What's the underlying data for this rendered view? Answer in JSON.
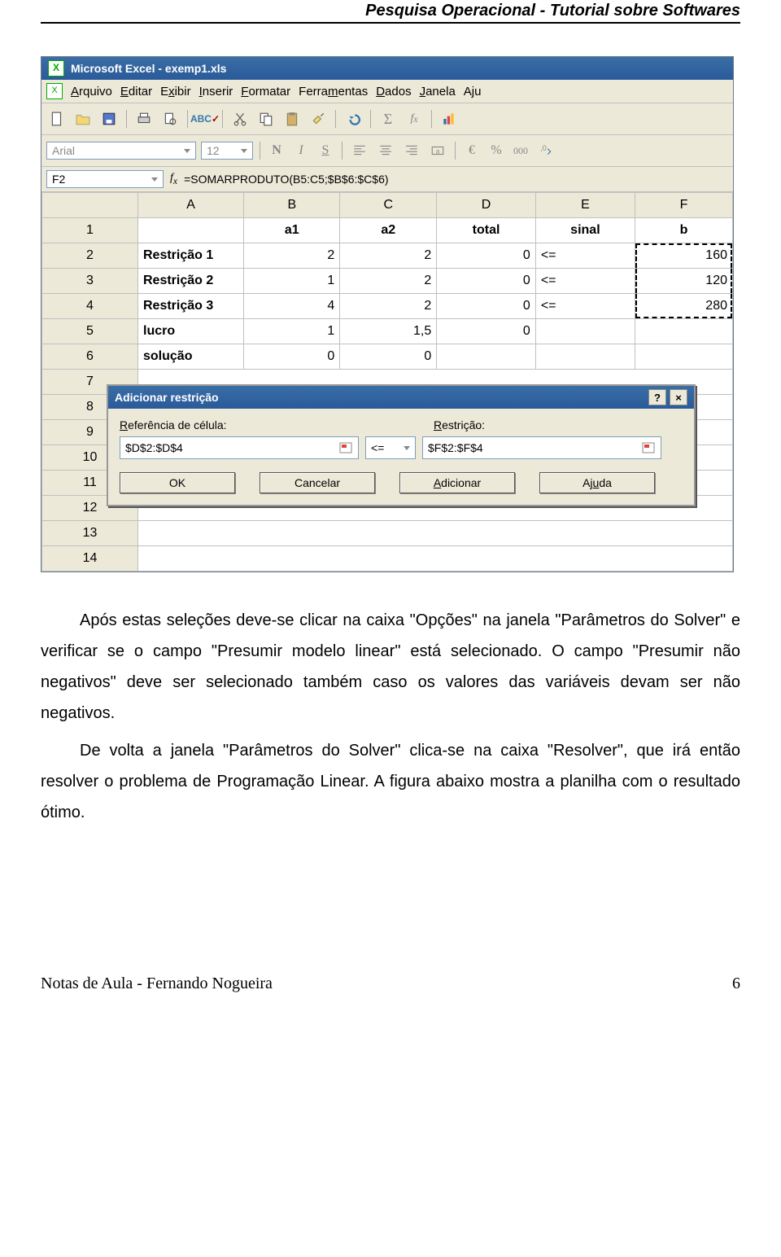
{
  "doc_header": "Pesquisa Operacional - Tutorial sobre Softwares",
  "excel": {
    "title": "Microsoft Excel - exemp1.xls",
    "menu": [
      "Arquivo",
      "Editar",
      "Exibir",
      "Inserir",
      "Formatar",
      "Ferramentas",
      "Dados",
      "Janela",
      "Aju"
    ],
    "menu_underline": [
      "A",
      "E",
      "x",
      "I",
      "F",
      "m",
      "D",
      "J",
      ""
    ],
    "font_name": "Arial",
    "font_size": "12",
    "name_box": "F2",
    "formula": "=SOMARPRODUTO(B5:C5;$B$6:$C$6)",
    "format_extras": {
      "currency": "€",
      "percent": "%",
      "thousands": "000"
    },
    "columns": [
      "A",
      "B",
      "C",
      "D",
      "E",
      "F"
    ],
    "headers_row": {
      "B": "a1",
      "C": "a2",
      "D": "total",
      "E": "sinal",
      "F": "b"
    },
    "rows": [
      {
        "n": "1",
        "A": "",
        "B": "a1",
        "C": "a2",
        "D": "total",
        "E": "sinal",
        "F": "b",
        "bold": true,
        "align": "ctr"
      },
      {
        "n": "2",
        "A": "Restrição 1",
        "B": "2",
        "C": "2",
        "D": "0",
        "E": "<=",
        "F": "160"
      },
      {
        "n": "3",
        "A": "Restrição 2",
        "B": "1",
        "C": "2",
        "D": "0",
        "E": "<=",
        "F": "120"
      },
      {
        "n": "4",
        "A": "Restrição 3",
        "B": "4",
        "C": "2",
        "D": "0",
        "E": "<=",
        "F": "280"
      },
      {
        "n": "5",
        "A": "lucro",
        "B": "1",
        "C": "1,5",
        "D": "0",
        "E": "",
        "F": ""
      },
      {
        "n": "6",
        "A": "solução",
        "B": "0",
        "C": "0",
        "D": "",
        "E": "",
        "F": ""
      },
      {
        "n": "7"
      },
      {
        "n": "8"
      },
      {
        "n": "9"
      },
      {
        "n": "10"
      },
      {
        "n": "11"
      },
      {
        "n": "12"
      },
      {
        "n": "13"
      },
      {
        "n": "14"
      }
    ]
  },
  "dialog": {
    "title": "Adicionar restrição",
    "label_ref": "Referência de célula:",
    "label_restr": "Restrição:",
    "ref_value": "$D$2:$D$4",
    "op_value": "<=",
    "restr_value": "$F$2:$F$4",
    "btns": {
      "ok": "OK",
      "cancel": "Cancelar",
      "add": "Adicionar",
      "help": "Ajuda"
    },
    "btn_underline": {
      "cancel": "",
      "add": "A",
      "help": "u",
      "ref": "R",
      "restr": "R"
    }
  },
  "paragraphs": {
    "p1": "Após estas seleções deve-se clicar na caixa \"Opções\" na janela \"Parâmetros do Solver\" e verificar se o campo \"Presumir modelo linear\" está selecionado. O campo \"Presumir não negativos\" deve ser selecionado também caso os valores das variáveis devam ser não negativos.",
    "p2": "De volta a janela \"Parâmetros do Solver\" clica-se na caixa \"Resolver\", que irá então resolver o problema de Programação Linear. A figura abaixo mostra a planilha com o resultado ótimo."
  },
  "footer": {
    "left": "Notas de Aula - Fernando Nogueira",
    "right": "6"
  }
}
